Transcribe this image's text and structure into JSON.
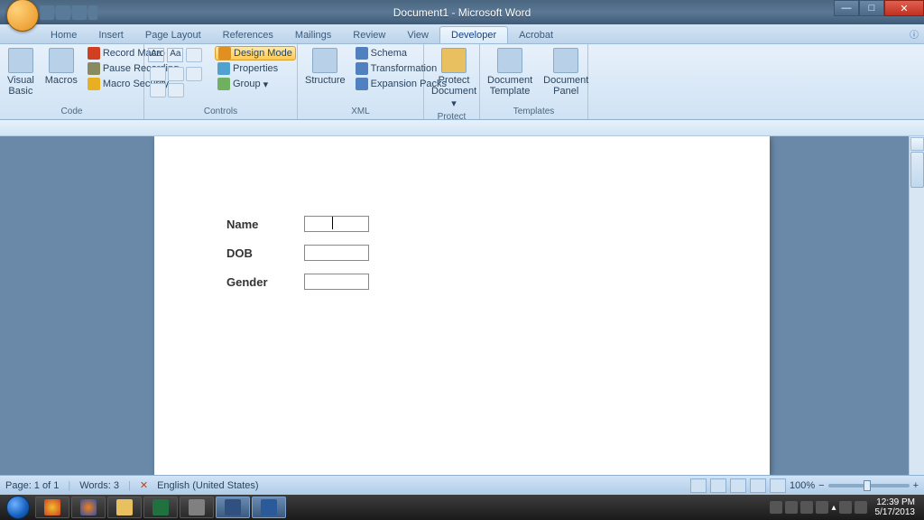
{
  "titlebar": {
    "title": "Document1 - Microsoft Word"
  },
  "tabs": [
    "Home",
    "Insert",
    "Page Layout",
    "References",
    "Mailings",
    "Review",
    "View",
    "Developer",
    "Acrobat"
  ],
  "active_tab": "Developer",
  "ribbon": {
    "code": {
      "visual_basic": "Visual\nBasic",
      "macros": "Macros",
      "record": "Record Macro",
      "pause": "Pause Recording",
      "security": "Macro Security",
      "group": "Code"
    },
    "controls": {
      "design_mode": "Design Mode",
      "properties": "Properties",
      "group_btn": "Group",
      "group": "Controls"
    },
    "xml": {
      "structure": "Structure",
      "schema": "Schema",
      "transformation": "Transformation",
      "expansion": "Expansion Packs",
      "group": "XML"
    },
    "protect": {
      "protect_doc": "Protect\nDocument",
      "group": "Protect"
    },
    "templates": {
      "template": "Document\nTemplate",
      "panel": "Document\nPanel",
      "group": "Templates"
    }
  },
  "document": {
    "fields": [
      {
        "label": "Name",
        "has_cursor": true
      },
      {
        "label": "DOB",
        "has_cursor": false
      },
      {
        "label": "Gender",
        "has_cursor": false
      }
    ]
  },
  "statusbar": {
    "page": "Page: 1 of 1",
    "words": "Words: 3",
    "lang": "English (United States)",
    "zoom": "100%"
  },
  "taskbar": {
    "time": "12:39 PM",
    "date": "5/17/2013"
  }
}
